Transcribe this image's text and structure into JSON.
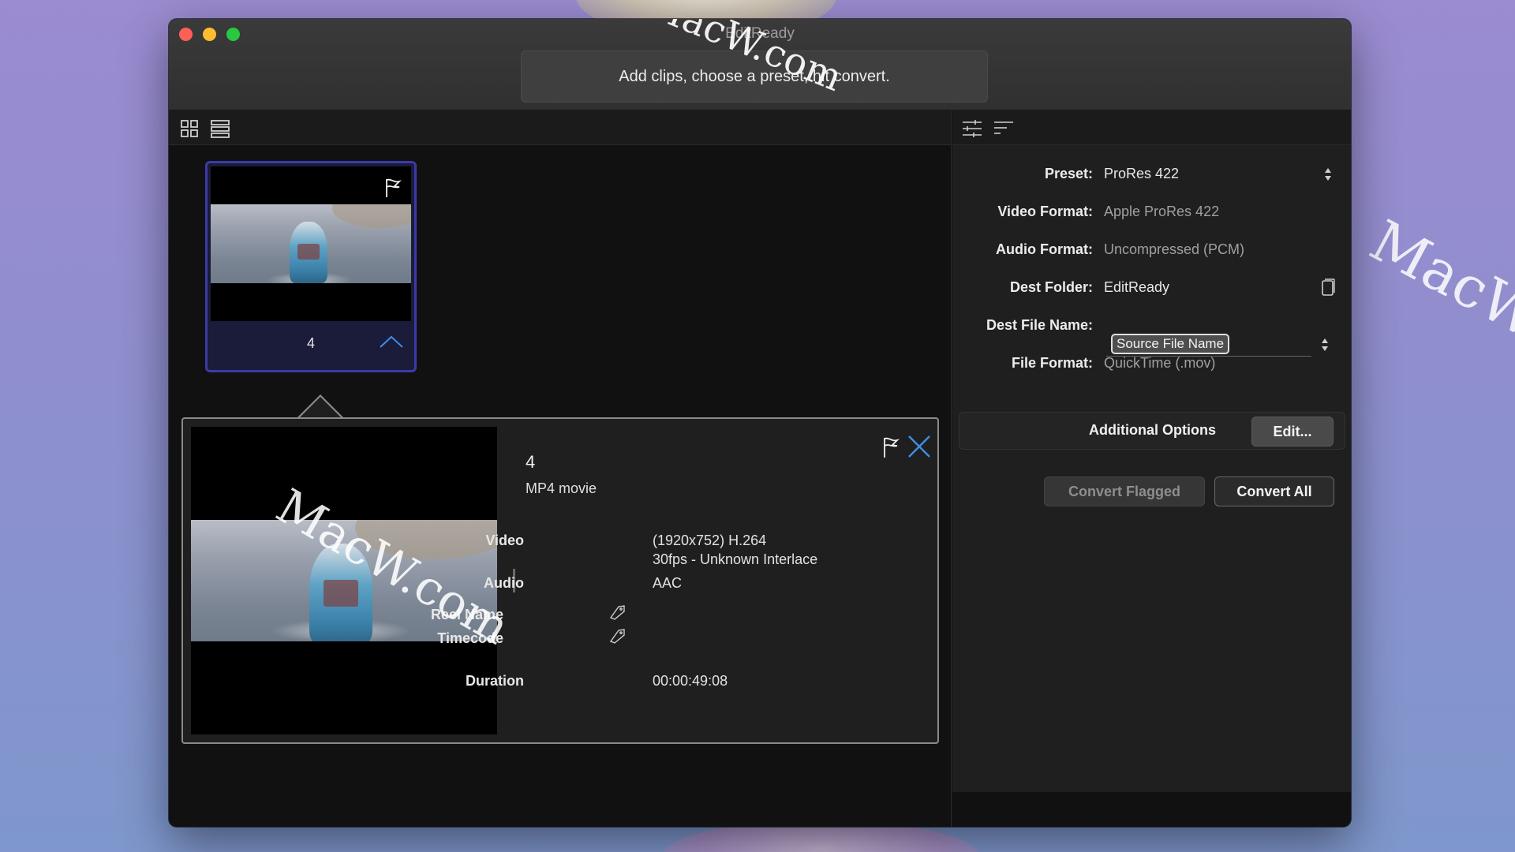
{
  "window": {
    "title": "EditReady",
    "instruction": "Add clips, choose a preset, hit convert."
  },
  "watermark": "MacW.com",
  "left_toolbar": {
    "icons": [
      "grid-view-icon",
      "list-view-icon"
    ]
  },
  "clip": {
    "name": "4",
    "icons": [
      "flag-icon",
      "chevron-up-icon"
    ]
  },
  "detail": {
    "title": "4",
    "kind": "MP4 movie",
    "rows": {
      "video_label": "Video",
      "video_value_1": "(1920x752) H.264",
      "video_value_2": "30fps - Unknown Interlace",
      "audio_label": "Audio",
      "audio_value": "AAC",
      "reel_label": "Reel Name",
      "timecode_label": "Timecode",
      "duration_label": "Duration",
      "duration_value": "00:00:49:08"
    }
  },
  "settings": {
    "preset_label": "Preset:",
    "preset_value": "ProRes 422",
    "video_format_label": "Video Format:",
    "video_format_value": "Apple ProRes 422",
    "audio_format_label": "Audio Format:",
    "audio_format_value": "Uncompressed (PCM)",
    "dest_folder_label": "Dest Folder:",
    "dest_folder_value": "EditReady",
    "dest_file_label": "Dest File Name:",
    "dest_file_token": "Source File Name",
    "file_format_label": "File Format:",
    "file_format_value": "QuickTime (.mov)",
    "additional_options_label": "Additional Options",
    "edit_button": "Edit...",
    "convert_flagged_button": "Convert Flagged",
    "convert_all_button": "Convert All"
  },
  "colors": {
    "accent": "#3b3ba8",
    "close_x": "#3d8ee8"
  }
}
